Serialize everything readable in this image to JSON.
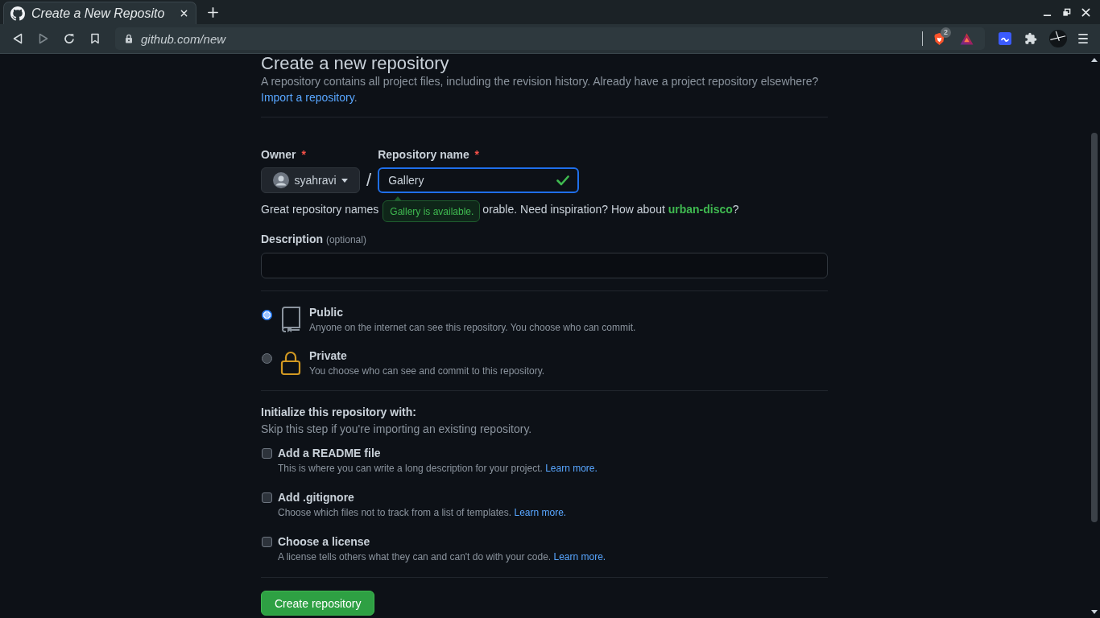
{
  "browser": {
    "tabs": [
      {
        "title": "Create a New Reposito",
        "selected": true
      }
    ],
    "address": "github.com/new",
    "shield_badge": "2"
  },
  "page": {
    "title": "Create a new repository",
    "intro": {
      "text": "A repository contains all project files, including the revision history. Already have a project repository elsewhere?",
      "link": "Import a repository",
      "end": "."
    },
    "owner": {
      "label": "Owner",
      "required_mark": "*",
      "value": "syahravi"
    },
    "path_separator": "/",
    "repository_name": {
      "label": "Repository name",
      "required_mark": "*",
      "value": "Gallery",
      "valid": true
    },
    "availability_tooltip": "Gallery is available.",
    "name_hint": {
      "before": "Great repository names",
      "after": "orable. Need inspiration? How about",
      "suggestion": "urban-disco",
      "end": "?"
    },
    "description": {
      "label": "Description",
      "note": "(optional)"
    },
    "visibility": [
      {
        "kind": "public",
        "label": "Public",
        "text": "Anyone on the internet can see this repository. You choose who can commit.",
        "selected": true
      },
      {
        "kind": "private",
        "label": "Private",
        "text": "You choose who can see and commit to this repository.",
        "selected": false
      }
    ],
    "initialize": {
      "title": "Initialize this repository with:",
      "subtitle": "Skip this step if you're importing an existing repository.",
      "options": [
        {
          "label": "Add a README file",
          "text": "This is where you can write a long description for your project.",
          "link": "Learn more.",
          "checked": false
        },
        {
          "label": "Add .gitignore",
          "text": "Choose which files not to track from a list of templates.",
          "link": "Learn more.",
          "checked": false
        },
        {
          "label": "Choose a license",
          "text": "A license tells others what they can and can't do with your code.",
          "link": "Learn more.",
          "checked": false
        }
      ]
    },
    "submit": "Create repository"
  }
}
